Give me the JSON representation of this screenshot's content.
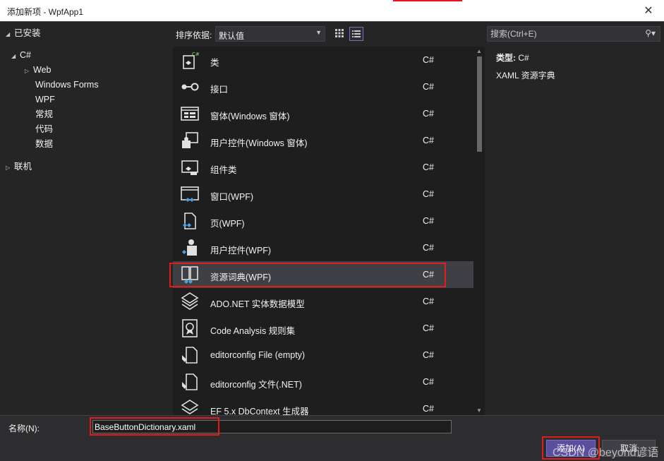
{
  "window": {
    "title": "添加新项 - WpfApp1",
    "close_icon": "✕"
  },
  "tree": {
    "installed": "已安装",
    "csharp": "C#",
    "children": [
      "Web",
      "Windows Forms",
      "WPF",
      "常规",
      "代码",
      "数据"
    ],
    "online": "联机"
  },
  "toolbar": {
    "sort_label": "排序依据:",
    "sort_value": "默认值"
  },
  "search": {
    "placeholder": "搜索(Ctrl+E)"
  },
  "templates": [
    {
      "name": "类",
      "lang": "C#",
      "icon": "class-icon"
    },
    {
      "name": "接口",
      "lang": "C#",
      "icon": "interface-icon"
    },
    {
      "name": "窗体(Windows 窗体)",
      "lang": "C#",
      "icon": "windows-form-icon"
    },
    {
      "name": "用户控件(Windows 窗体)",
      "lang": "C#",
      "icon": "user-control-icon"
    },
    {
      "name": "组件类",
      "lang": "C#",
      "icon": "component-class-icon"
    },
    {
      "name": "窗口(WPF)",
      "lang": "C#",
      "icon": "wpf-window-icon"
    },
    {
      "name": "页(WPF)",
      "lang": "C#",
      "icon": "wpf-page-icon"
    },
    {
      "name": "用户控件(WPF)",
      "lang": "C#",
      "icon": "wpf-user-control-icon"
    },
    {
      "name": "资源词典(WPF)",
      "lang": "C#",
      "icon": "resource-dictionary-icon"
    },
    {
      "name": "ADO.NET 实体数据模型",
      "lang": "C#",
      "icon": "entity-model-icon"
    },
    {
      "name": "Code Analysis 规则集",
      "lang": "C#",
      "icon": "ruleset-icon"
    },
    {
      "name": "editorconfig File (empty)",
      "lang": "C#",
      "icon": "editorconfig-icon"
    },
    {
      "name": "editorconfig 文件(.NET)",
      "lang": "C#",
      "icon": "editorconfig-icon"
    },
    {
      "name": "EF 5.x DbContext 生成器",
      "lang": "C#",
      "icon": "dbcontext-icon"
    }
  ],
  "details": {
    "type_label": "类型:",
    "type_value": "C#",
    "description": "XAML 资源字典"
  },
  "name_field": {
    "label": "名称(N):",
    "value": "BaseButtonDictionary.xaml"
  },
  "buttons": {
    "add": "添加(A)",
    "cancel": "取消"
  },
  "watermark": "CSDN @beyond谚语",
  "colors": {
    "accent": "#5a4e9e",
    "highlight_red": "#e21b1b",
    "background": "#252526",
    "list_bg": "#1e1e1e"
  }
}
